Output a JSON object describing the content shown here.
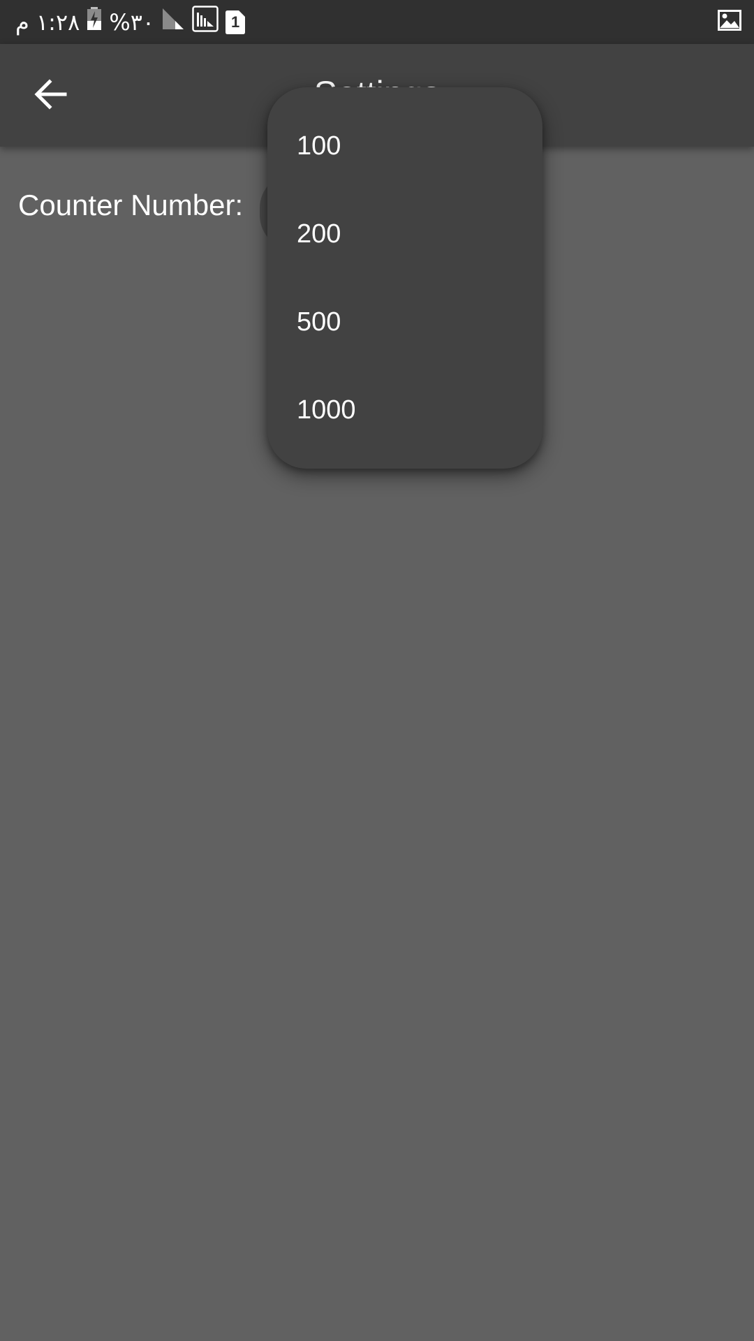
{
  "status_bar": {
    "time": "۱:۲۸ م",
    "battery": "٣٠%",
    "sim_badge": "1",
    "icons": [
      "battery-charging-icon",
      "signal-icon",
      "signal-box-icon",
      "sim-icon",
      "image-icon"
    ]
  },
  "app_bar": {
    "title": "Settings",
    "back_icon": "arrow-back-icon"
  },
  "content": {
    "counter_label": "Counter Number:"
  },
  "dropdown": {
    "options": [
      "100",
      "200",
      "500",
      "1000"
    ]
  },
  "colors": {
    "background": "#616161",
    "status_bar": "#303030",
    "app_bar": "#424242",
    "menu": "#424242",
    "text": "#FFFFFF"
  }
}
